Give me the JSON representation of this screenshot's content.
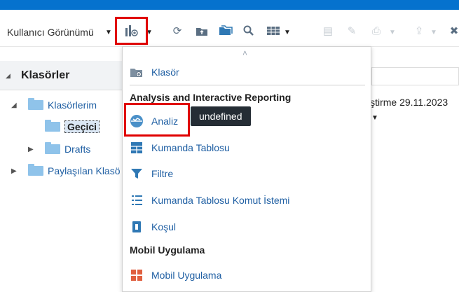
{
  "toolbar": {
    "view_label": "Kullanıcı Görünümü"
  },
  "left_panel": {
    "title": "Klasörler",
    "tree": [
      {
        "label": "Klasörlerim",
        "expanded": true
      },
      {
        "label": "Geçici",
        "selected": true
      },
      {
        "label": "Drafts",
        "expanded": false
      },
      {
        "label": "Paylaşılan Klasö",
        "expanded": false
      }
    ]
  },
  "background": {
    "modified_text": "iştirme 29.11.2023"
  },
  "dropdown": {
    "up_arrow": "˄",
    "top_item": {
      "label": "Klasör",
      "icon": "folder-add-icon"
    },
    "section_analysis": "Analysis and Interactive Reporting",
    "analysis_items": [
      {
        "label": "Analiz",
        "icon": "analysis-icon",
        "color": "#4a90c8"
      },
      {
        "label": "Kumanda Tablosu",
        "icon": "dashboard-icon",
        "color": "#2f78b4"
      },
      {
        "label": "Filtre",
        "icon": "filter-icon",
        "color": "#2f78b4"
      },
      {
        "label": "Kumanda Tablosu Komut İstemi",
        "icon": "dashboard-prompt-icon",
        "color": "#2f78b4"
      },
      {
        "label": "Koşul",
        "icon": "condition-icon",
        "color": "#2f78b4"
      }
    ],
    "section_mobile": "Mobil Uygulama",
    "mobile_items": [
      {
        "label": "Mobil Uygulama",
        "icon": "mobile-app-icon",
        "color": "#e06040"
      }
    ]
  },
  "tooltip": {
    "text": "undefined"
  },
  "colors": {
    "topbar": "#0572ce",
    "highlight": "#e00000",
    "link": "#1f5fa3"
  }
}
